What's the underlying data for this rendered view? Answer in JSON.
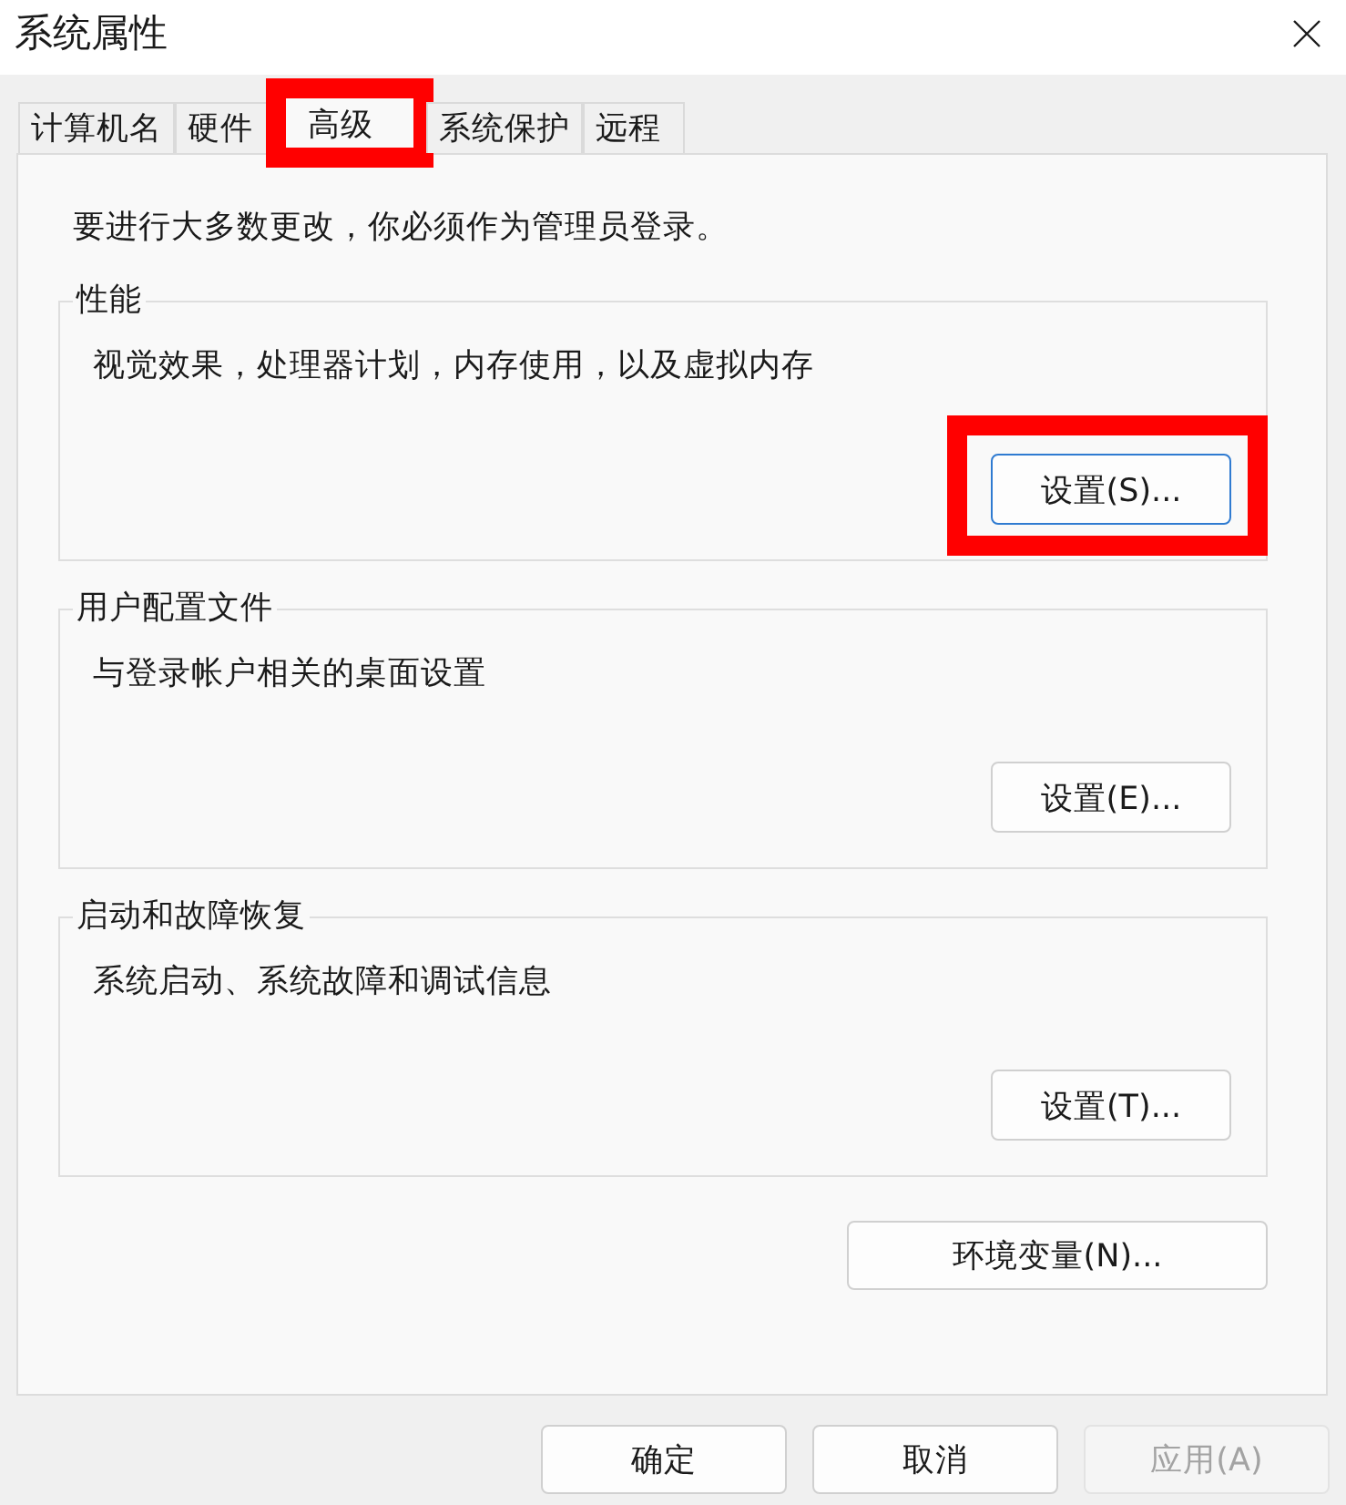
{
  "window": {
    "title": "系统属性"
  },
  "tabs": [
    {
      "label": "计算机名",
      "selected": false,
      "highlighted": false
    },
    {
      "label": "硬件",
      "selected": false,
      "highlighted": false
    },
    {
      "label": "高级",
      "selected": true,
      "highlighted": true
    },
    {
      "label": "系统保护",
      "selected": false,
      "highlighted": false
    },
    {
      "label": "远程",
      "selected": false,
      "highlighted": false
    }
  ],
  "notice": "要进行大多数更改，你必须作为管理员登录。",
  "groups": [
    {
      "title": "性能",
      "description": "视觉效果，处理器计划，内存使用，以及虚拟内存",
      "button": {
        "label": "设置(S)...",
        "default": true,
        "highlighted": true
      }
    },
    {
      "title": "用户配置文件",
      "description": "与登录帐户相关的桌面设置",
      "button": {
        "label": "设置(E)...",
        "default": false,
        "highlighted": false
      }
    },
    {
      "title": "启动和故障恢复",
      "description": "系统启动、系统故障和调试信息",
      "button": {
        "label": "设置(T)...",
        "default": false,
        "highlighted": false
      }
    }
  ],
  "environment_button": {
    "label": "环境变量(N)..."
  },
  "footer_buttons": [
    {
      "label": "确定",
      "disabled": false
    },
    {
      "label": "取消",
      "disabled": false
    },
    {
      "label": "应用(A)",
      "disabled": true
    }
  ]
}
